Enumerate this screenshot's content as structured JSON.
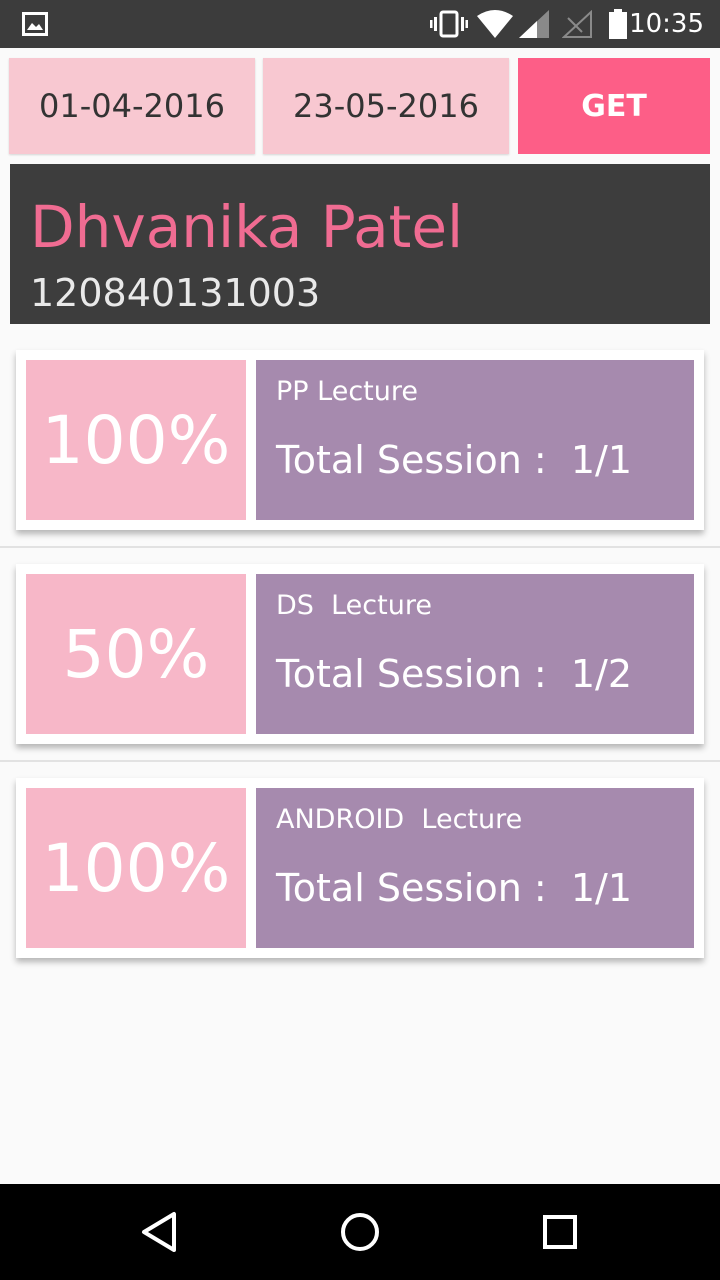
{
  "status_bar": {
    "time": "10:35",
    "icons": [
      "image-notification-icon",
      "vibrate-icon",
      "wifi-icon",
      "signal-icon",
      "signal-empty-icon",
      "battery-icon"
    ]
  },
  "filters": {
    "from_date": "01-04-2016",
    "to_date": "23-05-2016",
    "get_label": "GET"
  },
  "student": {
    "name": "Dhvanika Patel",
    "id": "120840131003"
  },
  "lectures": [
    {
      "percent": "100%",
      "name": "PP Lecture",
      "session": "Total Session :  1/1"
    },
    {
      "percent": "50%",
      "name": "DS  Lecture",
      "session": "Total Session :  1/2"
    },
    {
      "percent": "100%",
      "name": "ANDROID  Lecture",
      "session": "Total Session :  1/1"
    }
  ],
  "nav_bar": {
    "icons": [
      "back-icon",
      "home-icon",
      "recents-icon"
    ]
  },
  "colors": {
    "status_bar": "#3c3c3c",
    "date_box": "#f8c8d1",
    "get_button": "#fd5e87",
    "student_panel": "#3d3d3d",
    "student_name": "#f06c92",
    "percent_box": "#f7b7c8",
    "info_box": "#a68aae",
    "nav_bar": "#000000"
  }
}
